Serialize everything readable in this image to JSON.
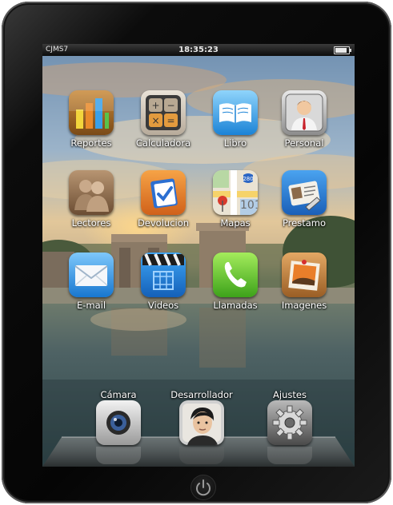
{
  "status_bar": {
    "carrier": "CJMS7",
    "time": "18:35:23",
    "battery_icon": "battery-icon"
  },
  "apps": [
    {
      "label": "Reportes",
      "icon": "bar-chart-icon"
    },
    {
      "label": "Calculadora",
      "icon": "calculator-icon"
    },
    {
      "label": "Libro",
      "icon": "book-icon"
    },
    {
      "label": "Personal",
      "icon": "person-icon"
    },
    {
      "label": "Lectores",
      "icon": "readers-icon"
    },
    {
      "label": "Devolucion",
      "icon": "return-check-icon"
    },
    {
      "label": "Mapas",
      "icon": "map-icon"
    },
    {
      "label": "Prestamo",
      "icon": "loan-card-icon"
    },
    {
      "label": "E-mail",
      "icon": "mail-icon"
    },
    {
      "label": "Videos",
      "icon": "clapperboard-icon"
    },
    {
      "label": "Llamadas",
      "icon": "phone-icon"
    },
    {
      "label": "Imagenes",
      "icon": "photo-icon"
    }
  ],
  "dock": [
    {
      "label": "Cámara",
      "icon": "camera-icon"
    },
    {
      "label": "Desarrollador",
      "icon": "developer-avatar-icon"
    },
    {
      "label": "Ajustes",
      "icon": "gear-icon"
    }
  ],
  "map_badge": "280",
  "colors": {
    "bezel": "#0a0a0a",
    "sky_top": "#7a9bbd",
    "sunset": "#f3a35a",
    "water": "#3f5a5e",
    "label_text": "#ffffff"
  }
}
